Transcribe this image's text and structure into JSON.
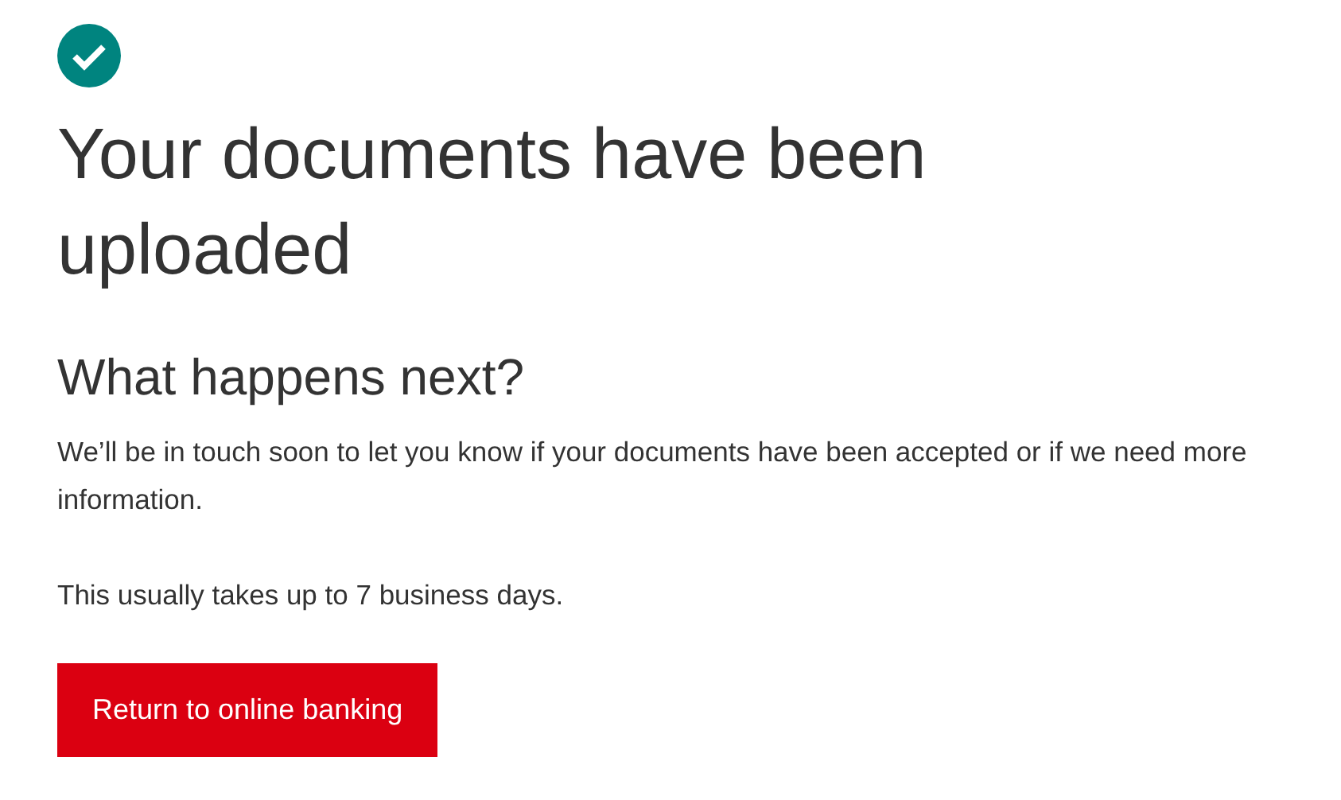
{
  "status": {
    "kind": "success"
  },
  "title": "Your documents have been uploaded",
  "subtitle": "What happens next?",
  "paragraphs": [
    "We’ll be in touch soon to let you know if your documents have been accepted or if we need more information.",
    "This usually takes up to 7 business days."
  ],
  "button": {
    "label": "Return to online banking"
  }
}
